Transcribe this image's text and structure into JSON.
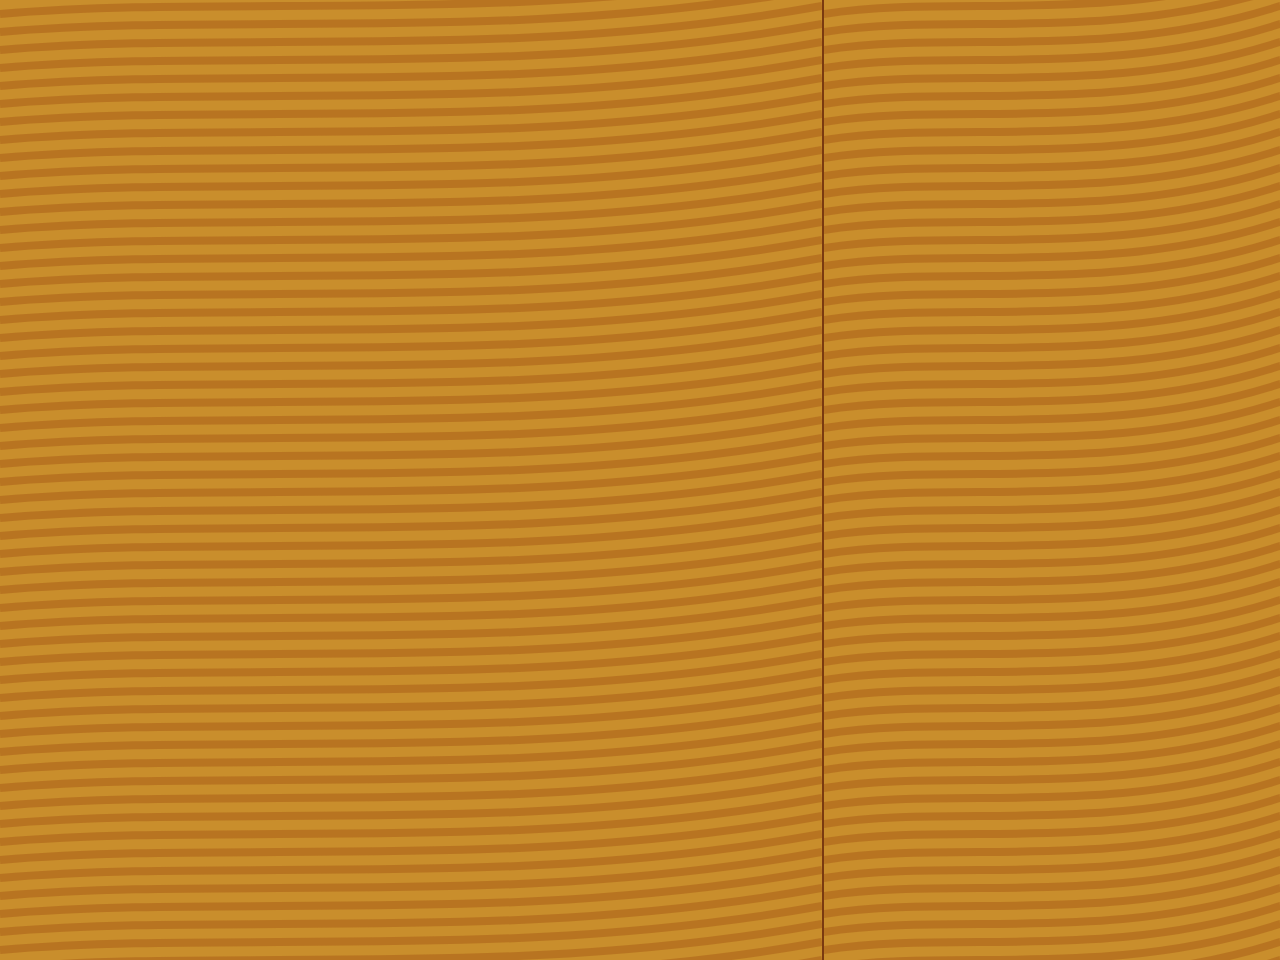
{
  "panels": [
    {
      "kind": "wood"
    },
    {
      "kind": "wood"
    }
  ]
}
